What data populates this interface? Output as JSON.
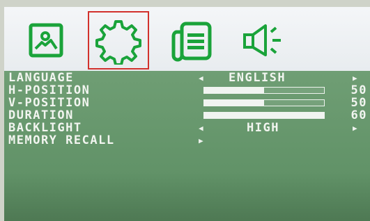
{
  "tabs": [
    {
      "name": "picture",
      "icon": "image-icon",
      "selected": false
    },
    {
      "name": "settings",
      "icon": "gear-icon",
      "selected": true
    },
    {
      "name": "info",
      "icon": "document-icon",
      "selected": false
    },
    {
      "name": "audio",
      "icon": "speaker-icon",
      "selected": false
    }
  ],
  "menu": {
    "language": {
      "label": "LANGUAGE",
      "value": "ENGLISH"
    },
    "h_position": {
      "label": "H-POSITION",
      "value": "50",
      "level": 0.5
    },
    "v_position": {
      "label": "V-POSITION",
      "value": "50",
      "level": 0.5
    },
    "duration": {
      "label": "DURATION",
      "value": "60",
      "level": 1.0
    },
    "backlight": {
      "label": "BACKLIGHT",
      "value": "HIGH"
    },
    "memory_recall": {
      "label": "MEMORY RECALL"
    }
  },
  "colors": {
    "accent_green": "#1aa33a",
    "selection_red": "#d2312c",
    "panel_green": "#62936a"
  }
}
